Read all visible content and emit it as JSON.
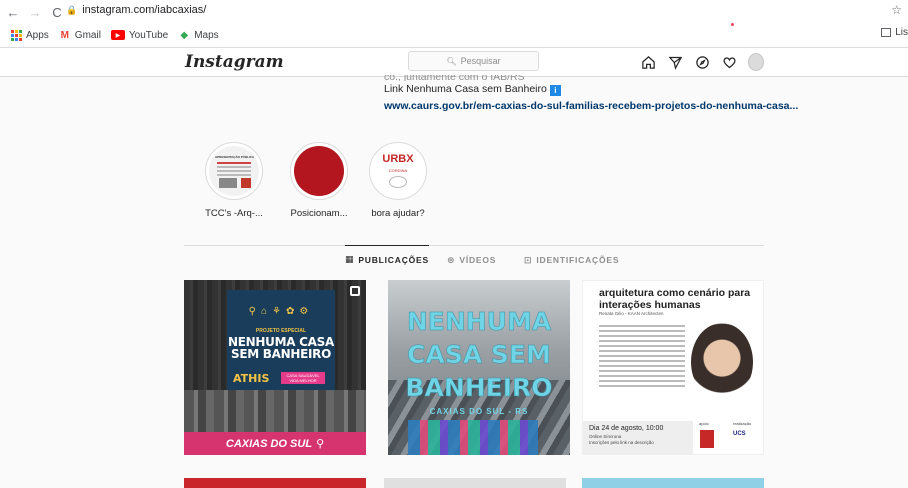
{
  "browser": {
    "url": "instagram.com/iabcaxias/",
    "bookmarks": [
      {
        "label": "Apps"
      },
      {
        "label": "Gmail"
      },
      {
        "label": "YouTube"
      },
      {
        "label": "Maps"
      }
    ],
    "reading_list": "Lis"
  },
  "header": {
    "logo": "Instagram",
    "search_placeholder": "Pesquisar"
  },
  "bio": {
    "line_cut": "co., juntamente com o IAB/RS",
    "line1": "Link Nenhuma Casa sem Banheiro",
    "link": "www.caurs.gov.br/em-caxias-do-sul-familias-recebem-projetos-do-nenhuma-casa..."
  },
  "highlights": [
    {
      "label": "TCC's -Arq-..."
    },
    {
      "label": "Posicionam..."
    },
    {
      "label": "bora ajudar?"
    }
  ],
  "highlight_content": {
    "h1_title": "APRESENTAÇÃO PÚBLICA",
    "h3_text": "URBX",
    "h3_sub": "CORDINA"
  },
  "tabs": [
    {
      "label": "PUBLICAÇÕES",
      "active": true
    },
    {
      "label": "VÍDEOS",
      "active": false
    },
    {
      "label": "IDENTIFICAÇÕES",
      "active": false
    }
  ],
  "posts": {
    "p1": {
      "project": "PROJETO ESPECIAL",
      "title": "NENHUMA CASA SEM BANHEIRO",
      "athis": "ATHIS",
      "tag": "CASA SAUDÁVEL VIDA MELHOR",
      "city": "CAXIAS DO SUL"
    },
    "p2": {
      "l1": "NENHUMA",
      "l2": "CASA SEM",
      "l3": "BANHEIRO",
      "sub": "CAXIAS DO SUL - RS"
    },
    "p3": {
      "title": "arquitetura como cenário para interações humanas",
      "author": "Renata Gilio - KAAN Architecten",
      "date": "Dia 24 de agosto, 10:00",
      "mode": "Online Síncrona",
      "signup": "Inscrições pelo link na descrição",
      "support": "apoio",
      "invite": "realização",
      "ucs": "UCS"
    }
  }
}
